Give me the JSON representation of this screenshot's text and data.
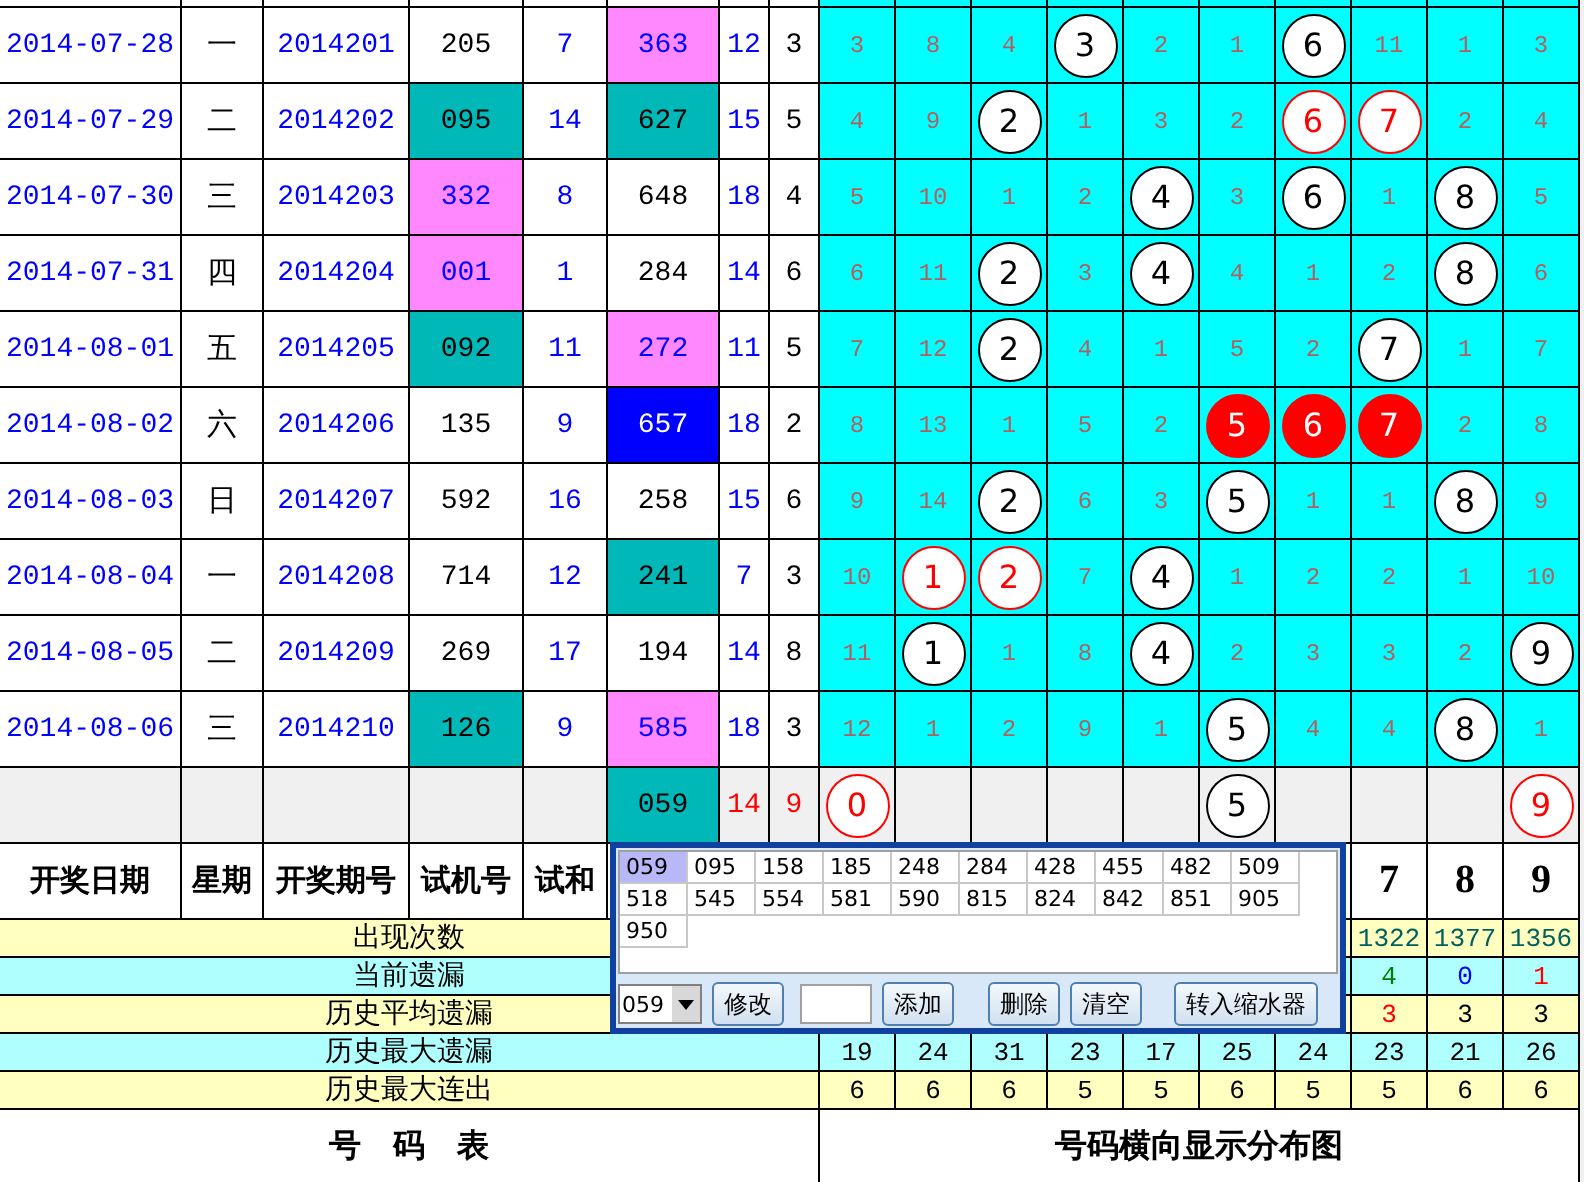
{
  "rows": [
    {
      "date": "2014-07-28",
      "weekday": "一",
      "period": "2014201",
      "test": {
        "value": "205",
        "color": "#ffffff"
      },
      "test_sum": "7",
      "draw": {
        "value": "363",
        "color": "#ff88ff"
      },
      "sum": "12",
      "span": "3",
      "cells": [
        {
          "kind": "miss",
          "text": "3"
        },
        {
          "kind": "miss",
          "text": "8"
        },
        {
          "kind": "miss",
          "text": "4"
        },
        {
          "kind": "ball",
          "text": "3"
        },
        {
          "kind": "miss",
          "text": "2"
        },
        {
          "kind": "miss",
          "text": "1"
        },
        {
          "kind": "ball",
          "text": "6"
        },
        {
          "kind": "miss",
          "text": "11"
        },
        {
          "kind": "miss",
          "text": "1"
        },
        {
          "kind": "miss",
          "text": "3"
        }
      ]
    },
    {
      "date": "2014-07-29",
      "weekday": "二",
      "period": "2014202",
      "test": {
        "value": "095",
        "color": "#00b8b8"
      },
      "test_sum": "14",
      "draw": {
        "value": "627",
        "color": "#00b8b8"
      },
      "sum": "15",
      "span": "5",
      "cells": [
        {
          "kind": "miss",
          "text": "4"
        },
        {
          "kind": "miss",
          "text": "9"
        },
        {
          "kind": "ball",
          "text": "2"
        },
        {
          "kind": "miss",
          "text": "1"
        },
        {
          "kind": "miss",
          "text": "3"
        },
        {
          "kind": "miss",
          "text": "2"
        },
        {
          "kind": "ball-repeat",
          "text": "6"
        },
        {
          "kind": "ball-repeat",
          "text": "7"
        },
        {
          "kind": "miss",
          "text": "2"
        },
        {
          "kind": "miss",
          "text": "4"
        }
      ]
    },
    {
      "date": "2014-07-30",
      "weekday": "三",
      "period": "2014203",
      "test": {
        "value": "332",
        "color": "#ff88ff"
      },
      "test_sum": "8",
      "draw": {
        "value": "648",
        "color": "#ffffff"
      },
      "sum": "18",
      "span": "4",
      "cells": [
        {
          "kind": "miss",
          "text": "5"
        },
        {
          "kind": "miss",
          "text": "10"
        },
        {
          "kind": "miss",
          "text": "1"
        },
        {
          "kind": "miss",
          "text": "2"
        },
        {
          "kind": "ball",
          "text": "4"
        },
        {
          "kind": "miss",
          "text": "3"
        },
        {
          "kind": "ball",
          "text": "6"
        },
        {
          "kind": "miss",
          "text": "1"
        },
        {
          "kind": "ball",
          "text": "8"
        },
        {
          "kind": "miss",
          "text": "5"
        }
      ]
    },
    {
      "date": "2014-07-31",
      "weekday": "四",
      "period": "2014204",
      "test": {
        "value": "001",
        "color": "#ff88ff"
      },
      "test_sum": "1",
      "draw": {
        "value": "284",
        "color": "#ffffff"
      },
      "sum": "14",
      "span": "6",
      "cells": [
        {
          "kind": "miss",
          "text": "6"
        },
        {
          "kind": "miss",
          "text": "11"
        },
        {
          "kind": "ball",
          "text": "2"
        },
        {
          "kind": "miss",
          "text": "3"
        },
        {
          "kind": "ball",
          "text": "4"
        },
        {
          "kind": "miss",
          "text": "4"
        },
        {
          "kind": "miss",
          "text": "1"
        },
        {
          "kind": "miss",
          "text": "2"
        },
        {
          "kind": "ball",
          "text": "8"
        },
        {
          "kind": "miss",
          "text": "6"
        }
      ]
    },
    {
      "date": "2014-08-01",
      "weekday": "五",
      "period": "2014205",
      "test": {
        "value": "092",
        "color": "#00b8b8"
      },
      "test_sum": "11",
      "draw": {
        "value": "272",
        "color": "#ff88ff"
      },
      "sum": "11",
      "span": "5",
      "cells": [
        {
          "kind": "miss",
          "text": "7"
        },
        {
          "kind": "miss",
          "text": "12"
        },
        {
          "kind": "ball",
          "text": "2"
        },
        {
          "kind": "miss",
          "text": "4"
        },
        {
          "kind": "miss",
          "text": "1"
        },
        {
          "kind": "miss",
          "text": "5"
        },
        {
          "kind": "miss",
          "text": "2"
        },
        {
          "kind": "ball",
          "text": "7"
        },
        {
          "kind": "miss",
          "text": "1"
        },
        {
          "kind": "miss",
          "text": "7"
        }
      ]
    },
    {
      "date": "2014-08-02",
      "weekday": "六",
      "period": "2014206",
      "test": {
        "value": "135",
        "color": "#ffffff"
      },
      "test_sum": "9",
      "draw": {
        "value": "657",
        "color": "#0000ff"
      },
      "sum": "18",
      "span": "2",
      "cells": [
        {
          "kind": "miss",
          "text": "8"
        },
        {
          "kind": "miss",
          "text": "13"
        },
        {
          "kind": "miss",
          "text": "1"
        },
        {
          "kind": "miss",
          "text": "5"
        },
        {
          "kind": "miss",
          "text": "2"
        },
        {
          "kind": "ball-hot",
          "text": "5"
        },
        {
          "kind": "ball-hot",
          "text": "6"
        },
        {
          "kind": "ball-hot",
          "text": "7"
        },
        {
          "kind": "miss",
          "text": "2"
        },
        {
          "kind": "miss",
          "text": "8"
        }
      ]
    },
    {
      "date": "2014-08-03",
      "weekday": "日",
      "period": "2014207",
      "test": {
        "value": "592",
        "color": "#ffffff"
      },
      "test_sum": "16",
      "draw": {
        "value": "258",
        "color": "#ffffff"
      },
      "sum": "15",
      "span": "6",
      "cells": [
        {
          "kind": "miss",
          "text": "9"
        },
        {
          "kind": "miss",
          "text": "14"
        },
        {
          "kind": "ball",
          "text": "2"
        },
        {
          "kind": "miss",
          "text": "6"
        },
        {
          "kind": "miss",
          "text": "3"
        },
        {
          "kind": "ball",
          "text": "5"
        },
        {
          "kind": "miss",
          "text": "1"
        },
        {
          "kind": "miss",
          "text": "1"
        },
        {
          "kind": "ball",
          "text": "8"
        },
        {
          "kind": "miss",
          "text": "9"
        }
      ]
    },
    {
      "date": "2014-08-04",
      "weekday": "一",
      "period": "2014208",
      "test": {
        "value": "714",
        "color": "#ffffff"
      },
      "test_sum": "12",
      "draw": {
        "value": "241",
        "color": "#00b8b8"
      },
      "sum": "7",
      "span": "3",
      "cells": [
        {
          "kind": "miss",
          "text": "10"
        },
        {
          "kind": "ball-repeat",
          "text": "1"
        },
        {
          "kind": "ball-repeat",
          "text": "2"
        },
        {
          "kind": "miss",
          "text": "7"
        },
        {
          "kind": "ball",
          "text": "4"
        },
        {
          "kind": "miss",
          "text": "1"
        },
        {
          "kind": "miss",
          "text": "2"
        },
        {
          "kind": "miss",
          "text": "2"
        },
        {
          "kind": "miss",
          "text": "1"
        },
        {
          "kind": "miss",
          "text": "10"
        }
      ]
    },
    {
      "date": "2014-08-05",
      "weekday": "二",
      "period": "2014209",
      "test": {
        "value": "269",
        "color": "#ffffff"
      },
      "test_sum": "17",
      "draw": {
        "value": "194",
        "color": "#ffffff"
      },
      "sum": "14",
      "span": "8",
      "cells": [
        {
          "kind": "miss",
          "text": "11"
        },
        {
          "kind": "ball",
          "text": "1"
        },
        {
          "kind": "miss",
          "text": "1"
        },
        {
          "kind": "miss",
          "text": "8"
        },
        {
          "kind": "ball",
          "text": "4"
        },
        {
          "kind": "miss",
          "text": "2"
        },
        {
          "kind": "miss",
          "text": "3"
        },
        {
          "kind": "miss",
          "text": "3"
        },
        {
          "kind": "miss",
          "text": "2"
        },
        {
          "kind": "ball",
          "text": "9"
        }
      ]
    },
    {
      "date": "2014-08-06",
      "weekday": "三",
      "period": "2014210",
      "test": {
        "value": "126",
        "color": "#00b8b8"
      },
      "test_sum": "9",
      "draw": {
        "value": "585",
        "color": "#ff88ff"
      },
      "sum": "18",
      "span": "3",
      "cells": [
        {
          "kind": "miss",
          "text": "12"
        },
        {
          "kind": "miss",
          "text": "1"
        },
        {
          "kind": "miss",
          "text": "2"
        },
        {
          "kind": "miss",
          "text": "9"
        },
        {
          "kind": "miss",
          "text": "1"
        },
        {
          "kind": "ball",
          "text": "5"
        },
        {
          "kind": "miss",
          "text": "4"
        },
        {
          "kind": "miss",
          "text": "4"
        },
        {
          "kind": "ball",
          "text": "8"
        },
        {
          "kind": "miss",
          "text": "1"
        }
      ]
    }
  ],
  "prediction": {
    "draw": {
      "value": "059",
      "color": "#00b8b8"
    },
    "sum": {
      "text": "14",
      "color": "#ff0000"
    },
    "span": {
      "text": "9",
      "color": "#ff0000"
    },
    "cells": [
      {
        "kind": "ball-repeat",
        "text": "0"
      },
      {
        "kind": "empty"
      },
      {
        "kind": "empty"
      },
      {
        "kind": "empty"
      },
      {
        "kind": "empty"
      },
      {
        "kind": "ball",
        "text": "5"
      },
      {
        "kind": "empty"
      },
      {
        "kind": "empty"
      },
      {
        "kind": "empty"
      },
      {
        "kind": "ball-repeat",
        "text": "9"
      }
    ]
  },
  "header": {
    "labels": [
      "开奖日期",
      "星期",
      "开奖期号",
      "试机号",
      "试和"
    ],
    "digits": [
      "7",
      "8",
      "9"
    ]
  },
  "stats": [
    {
      "label": "出现次数",
      "values": [
        {
          "text": "1322",
          "color": "#006060"
        },
        {
          "text": "1377",
          "color": "#006060"
        },
        {
          "text": "1356",
          "color": "#006060"
        }
      ]
    },
    {
      "label": "当前遗漏",
      "values": [
        {
          "text": "4",
          "color": "#008000"
        },
        {
          "text": "0",
          "color": "#0000ff"
        },
        {
          "text": "1",
          "color": "#ff0000"
        }
      ]
    },
    {
      "label": "历史平均遗漏",
      "values": [
        {
          "text": "3",
          "color": "#ff0000"
        },
        {
          "text": "3",
          "color": "#000000"
        },
        {
          "text": "3",
          "color": "#000000"
        }
      ]
    },
    {
      "label": "历史最大遗漏",
      "values": [
        {
          "text": "19",
          "color": "#000000"
        },
        {
          "text": "24",
          "color": "#000000"
        },
        {
          "text": "31",
          "color": "#000000"
        },
        {
          "text": "23",
          "color": "#000000"
        },
        {
          "text": "17",
          "color": "#000000"
        },
        {
          "text": "25",
          "color": "#000000"
        },
        {
          "text": "24",
          "color": "#000000"
        },
        {
          "text": "23",
          "color": "#000000"
        },
        {
          "text": "21",
          "color": "#000000"
        },
        {
          "text": "26",
          "color": "#000000"
        }
      ]
    },
    {
      "label": "历史最大连出",
      "values": [
        {
          "text": "6",
          "color": "#000000"
        },
        {
          "text": "6",
          "color": "#000000"
        },
        {
          "text": "6",
          "color": "#000000"
        },
        {
          "text": "5",
          "color": "#000000"
        },
        {
          "text": "5",
          "color": "#000000"
        },
        {
          "text": "6",
          "color": "#000000"
        },
        {
          "text": "5",
          "color": "#000000"
        },
        {
          "text": "5",
          "color": "#000000"
        },
        {
          "text": "6",
          "color": "#000000"
        },
        {
          "text": "6",
          "color": "#000000"
        }
      ]
    }
  ],
  "footer": {
    "left": "号　码　表",
    "right": "号码横向显示分布图"
  },
  "popup": {
    "numbers": [
      {
        "text": "059",
        "selected": true
      },
      {
        "text": "095",
        "selected": false
      },
      {
        "text": "158",
        "selected": false
      },
      {
        "text": "185",
        "selected": false
      },
      {
        "text": "248",
        "selected": false
      },
      {
        "text": "284",
        "selected": false
      },
      {
        "text": "428",
        "selected": false
      },
      {
        "text": "455",
        "selected": false
      },
      {
        "text": "482",
        "selected": false
      },
      {
        "text": "509",
        "selected": false
      },
      {
        "text": "518",
        "selected": false
      },
      {
        "text": "545",
        "selected": false
      },
      {
        "text": "554",
        "selected": false
      },
      {
        "text": "581",
        "selected": false
      },
      {
        "text": "590",
        "selected": false
      },
      {
        "text": "815",
        "selected": false
      },
      {
        "text": "824",
        "selected": false
      },
      {
        "text": "842",
        "selected": false
      },
      {
        "text": "851",
        "selected": false
      },
      {
        "text": "905",
        "selected": false
      },
      {
        "text": "950",
        "selected": false
      }
    ],
    "select_value": "059",
    "buttons": [
      "修改",
      "添加",
      "删除",
      "清空",
      "转入缩水器"
    ]
  }
}
